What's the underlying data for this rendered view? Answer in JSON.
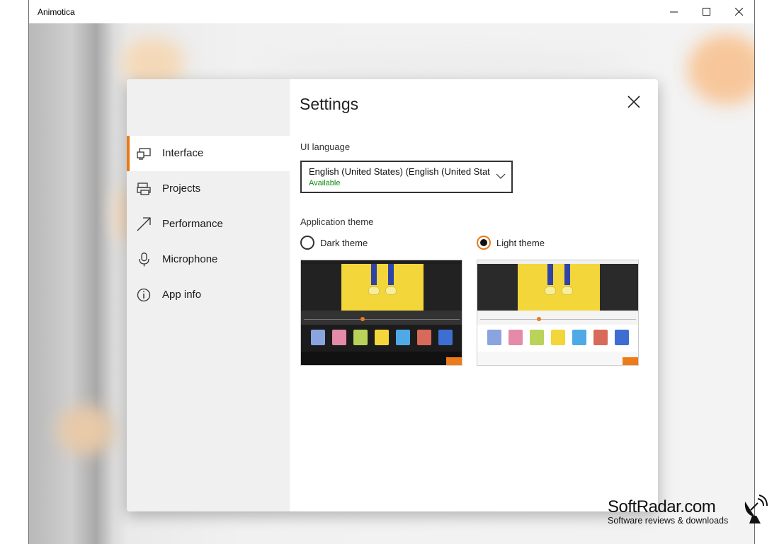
{
  "window": {
    "title": "Animotica",
    "controls": [
      "minimize",
      "maximize",
      "close"
    ]
  },
  "settings": {
    "title": "Settings",
    "nav": [
      {
        "label": "Interface",
        "icon": "display-icon",
        "active": true
      },
      {
        "label": "Projects",
        "icon": "printer-icon",
        "active": false
      },
      {
        "label": "Performance",
        "icon": "arrow-up-right-icon",
        "active": false
      },
      {
        "label": "Microphone",
        "icon": "microphone-icon",
        "active": false
      },
      {
        "label": "App info",
        "icon": "info-icon",
        "active": false
      }
    ],
    "ui_language": {
      "label": "UI language",
      "value": "English (United States) (English (United States))",
      "status": "Available"
    },
    "theme": {
      "label": "Application theme",
      "options": [
        {
          "label": "Dark theme",
          "selected": false
        },
        {
          "label": "Light theme",
          "selected": true
        }
      ]
    }
  },
  "watermark": {
    "brand": "SoftRadar.com",
    "tagline": "Software reviews & downloads"
  },
  "colors": {
    "accent": "#ea7a18",
    "available": "#108a10",
    "nav_bg": "#f0f0f0"
  }
}
